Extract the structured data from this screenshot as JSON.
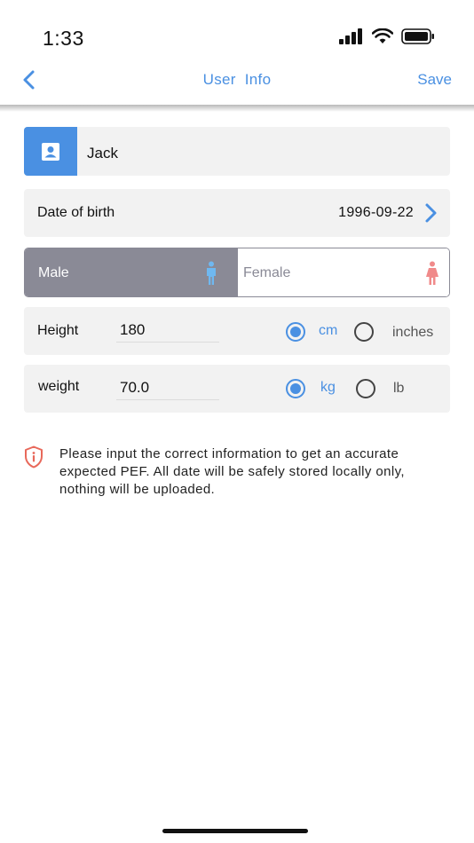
{
  "status_bar": {
    "time": "1:33"
  },
  "nav": {
    "title": "User  Info",
    "save_label": "Save"
  },
  "profile": {
    "name": "Jack"
  },
  "date_of_birth": {
    "label": "Date of birth",
    "value": "1996-09-22"
  },
  "gender": {
    "male_label": "Male",
    "female_label": "Female",
    "selected": "Male"
  },
  "height": {
    "label": "Height",
    "value": "180",
    "unit_cm": "cm",
    "unit_inches": "inches",
    "selected_unit": "cm"
  },
  "weight": {
    "label": "weight",
    "value": "70.0",
    "unit_kg": "kg",
    "unit_lb": "lb",
    "selected_unit": "kg"
  },
  "notice": {
    "text": "Please input the correct information to get an accurate expected PEF. All date will be safely stored locally only, nothing will be uploaded."
  },
  "colors": {
    "accent": "#4a90e2",
    "male_bg": "#8a8a96",
    "female_icon": "#f08a8a",
    "male_icon": "#6fb8f0",
    "warning": "#e8685a",
    "row_bg": "#f2f2f2"
  },
  "icons": {
    "back": "chevron-left-icon",
    "avatar": "contact-card-icon",
    "dob": "chevron-right-icon",
    "male": "male-figure-icon",
    "female": "female-figure-icon",
    "notice": "shield-info-icon"
  }
}
